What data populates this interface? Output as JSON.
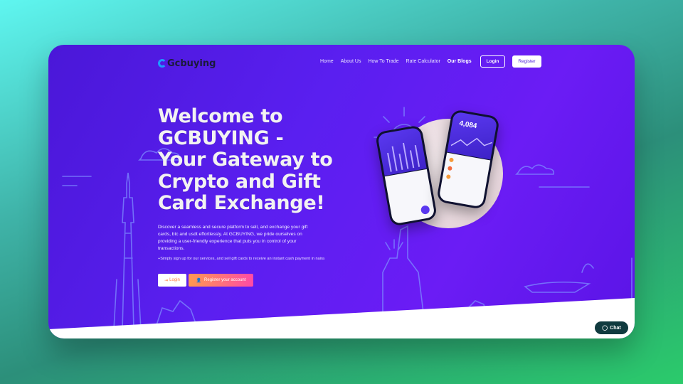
{
  "brand": {
    "logo_text": "Gcbuying"
  },
  "nav": {
    "items": [
      {
        "label": "Home"
      },
      {
        "label": "About Us"
      },
      {
        "label": "How To Trade"
      },
      {
        "label": "Rate Calculator"
      },
      {
        "label": "Our Blogs"
      }
    ],
    "login_label": "Login",
    "register_label": "Register"
  },
  "hero": {
    "title": "Welcome to GCBUYING - Your Gateway to Crypto and Gift Card Exchange!",
    "description": "Discover a seamless and secure platform to sell, and exchange your gift cards, btc and usdt effortlessly. At GCBUYING, we pride ourselves on providing a user-friendly experience that puts you in control of your transactions.",
    "note": "+Simply sign up for our services, and sell gift cards to receive an instant cash payment in naira",
    "cta_login": "Login",
    "cta_register": "Register your account"
  },
  "mockup": {
    "balance": "4,084"
  },
  "chat": {
    "label": "Chat"
  },
  "colors": {
    "hero_bg": "#5a1ff0",
    "cta_gradient_start": "#ff9a50",
    "cta_gradient_end": "#ff4aa6",
    "chat_bg": "#103a3f"
  }
}
